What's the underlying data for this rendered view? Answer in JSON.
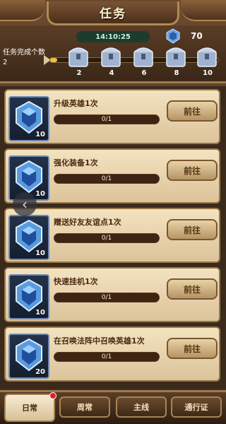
{
  "header": {
    "title": "任务",
    "timer": "14:10:25",
    "points": "70",
    "progress_label": "任务完成个数",
    "progress_count": "2",
    "progress_fraction": 0.04,
    "chests": [
      "2",
      "4",
      "6",
      "8",
      "10"
    ]
  },
  "tasks": [
    {
      "name": "升级英雄1次",
      "progress": "0/1",
      "reward": "10",
      "button": "前往"
    },
    {
      "name": "强化装备1次",
      "progress": "0/1",
      "reward": "10",
      "button": "前往"
    },
    {
      "name": "赠送好友友谊点1次",
      "progress": "0/1",
      "reward": "10",
      "button": "前往"
    },
    {
      "name": "快速挂机1次",
      "progress": "0/1",
      "reward": "10",
      "button": "前往"
    },
    {
      "name": "在召唤法阵中召唤英雄1次",
      "progress": "0/1",
      "reward": "20",
      "button": "前往"
    }
  ],
  "tabs": [
    {
      "label": "日常",
      "active": true,
      "badge": true
    },
    {
      "label": "周常",
      "active": false,
      "badge": false
    },
    {
      "label": "主线",
      "active": false,
      "badge": false
    },
    {
      "label": "通行证",
      "active": false,
      "badge": false
    }
  ],
  "back_icon": "chevron-left-icon",
  "colors": {
    "accent": "#f0c040",
    "badge": "#e02020"
  }
}
